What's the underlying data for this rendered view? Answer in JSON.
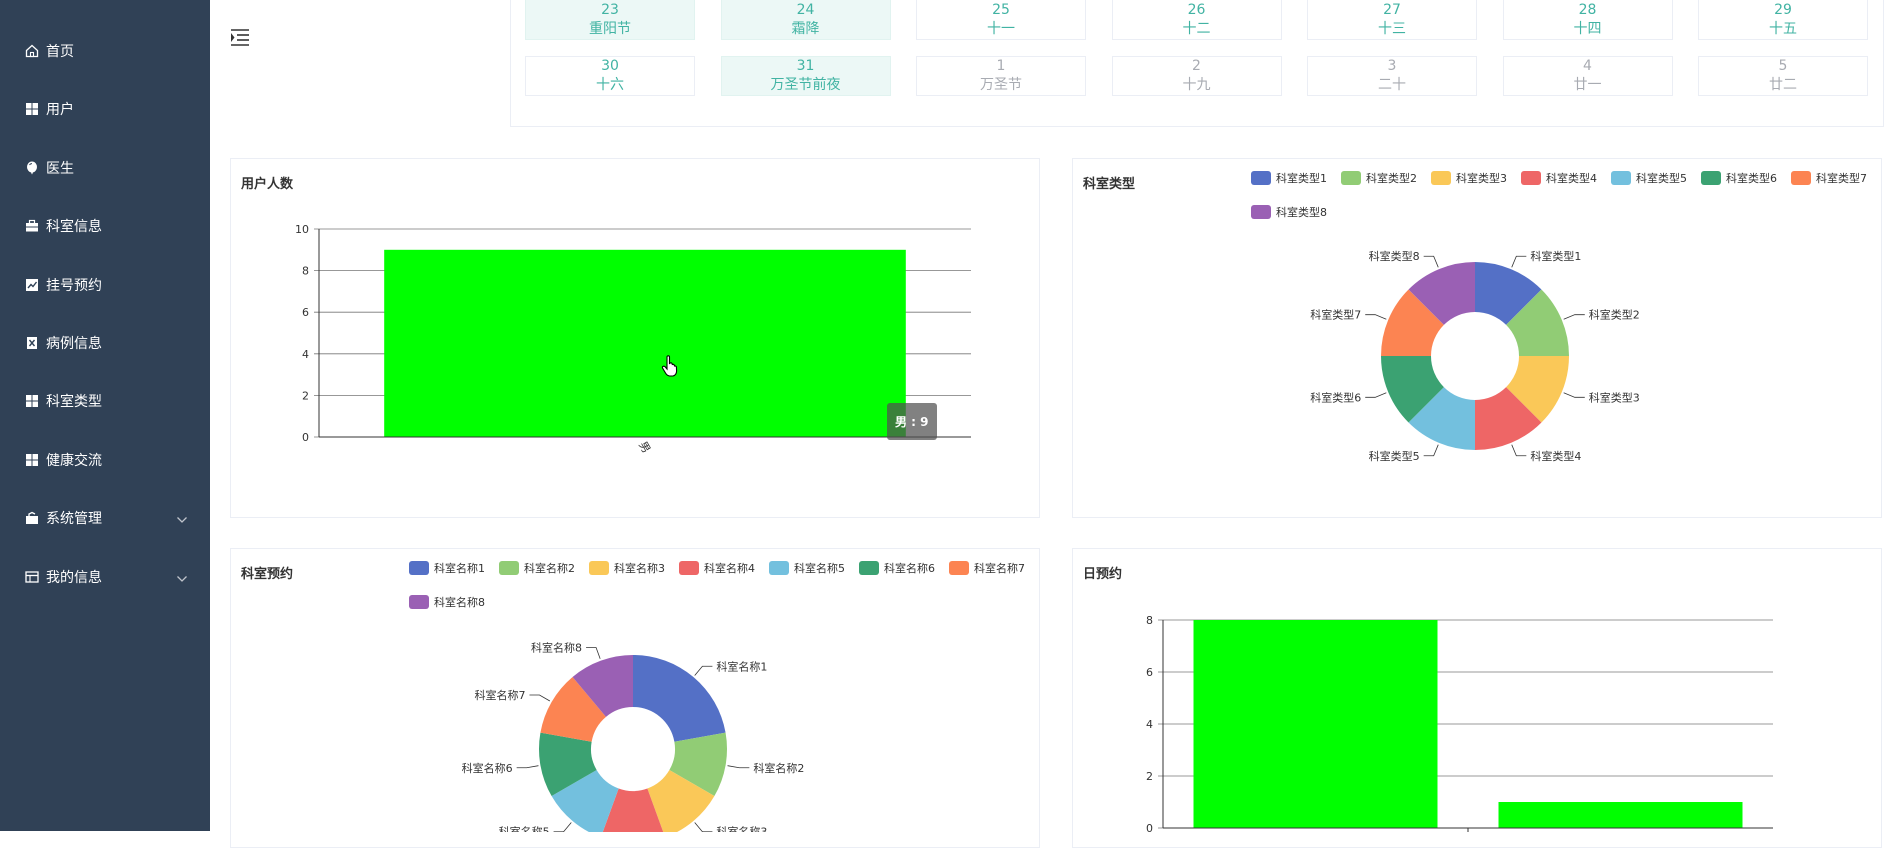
{
  "sidebar": {
    "items": [
      {
        "label": "首页",
        "icon": "home-icon"
      },
      {
        "label": "用户",
        "icon": "grid-icon"
      },
      {
        "label": "医生",
        "icon": "balloon-icon"
      },
      {
        "label": "科室信息",
        "icon": "briefcase-icon"
      },
      {
        "label": "挂号预约",
        "icon": "chart-icon"
      },
      {
        "label": "病例信息",
        "icon": "document-icon"
      },
      {
        "label": "科室类型",
        "icon": "grid-icon"
      },
      {
        "label": "健康交流",
        "icon": "grid-icon"
      },
      {
        "label": "系统管理",
        "icon": "toolbox-icon",
        "expandable": true
      },
      {
        "label": "我的信息",
        "icon": "card-icon",
        "expandable": true
      }
    ]
  },
  "calendar": {
    "rows": [
      [
        {
          "day": "23",
          "lunar": "重阳节",
          "current": true,
          "highlight": true
        },
        {
          "day": "24",
          "lunar": "霜降",
          "current": true,
          "highlight": true
        },
        {
          "day": "25",
          "lunar": "十一",
          "current": true
        },
        {
          "day": "26",
          "lunar": "十二",
          "current": true
        },
        {
          "day": "27",
          "lunar": "十三",
          "current": true
        },
        {
          "day": "28",
          "lunar": "十四",
          "current": true
        },
        {
          "day": "29",
          "lunar": "十五",
          "current": true
        }
      ],
      [
        {
          "day": "30",
          "lunar": "十六",
          "current": true
        },
        {
          "day": "31",
          "lunar": "万圣节前夜",
          "current": true,
          "highlight": true
        },
        {
          "day": "1",
          "lunar": "万圣节",
          "current": false
        },
        {
          "day": "2",
          "lunar": "十九",
          "current": false
        },
        {
          "day": "3",
          "lunar": "二十",
          "current": false
        },
        {
          "day": "4",
          "lunar": "廿一",
          "current": false
        },
        {
          "day": "5",
          "lunar": "廿二",
          "current": false
        }
      ]
    ]
  },
  "palette": [
    "#5470c6",
    "#91cc75",
    "#fac858",
    "#ee6666",
    "#73c0de",
    "#3ba272",
    "#fc8452",
    "#9a60b4"
  ],
  "panels": {
    "users": {
      "title": "用户人数",
      "tooltip": "男 : 9"
    },
    "dept_type": {
      "title": "科室类型"
    },
    "dept_booking": {
      "title": "科室预约"
    },
    "daily_booking": {
      "title": "日预约"
    }
  },
  "chart_data": [
    {
      "type": "bar",
      "title": "用户人数",
      "categories": [
        "男"
      ],
      "values": [
        9
      ],
      "ylim": [
        0,
        10
      ],
      "yticks": [
        0,
        2,
        4,
        6,
        8,
        10
      ],
      "color": "#00ff00",
      "grid": true
    },
    {
      "type": "pie",
      "title": "科室类型",
      "donut": true,
      "legend": "top-right",
      "labels": [
        "科室类型1",
        "科室类型2",
        "科室类型3",
        "科室类型4",
        "科室类型5",
        "科室类型6",
        "科室类型7",
        "科室类型8"
      ],
      "values": [
        1,
        1,
        1,
        1,
        1,
        1,
        1,
        1
      ]
    },
    {
      "type": "pie",
      "title": "科室预约",
      "donut": true,
      "legend": "top-right",
      "labels": [
        "科室名称1",
        "科室名称2",
        "科室名称3",
        "科室名称4",
        "科室名称5",
        "科室名称6",
        "科室名称7",
        "科室名称8"
      ],
      "values": [
        2,
        1,
        1,
        1,
        1,
        1,
        1,
        1
      ]
    },
    {
      "type": "bar",
      "title": "日预约",
      "categories": [
        "",
        ""
      ],
      "values": [
        8,
        1
      ],
      "ylim": [
        0,
        8
      ],
      "yticks": [
        0,
        2,
        4,
        6,
        8
      ],
      "color": "#00ff00",
      "grid": true
    }
  ]
}
